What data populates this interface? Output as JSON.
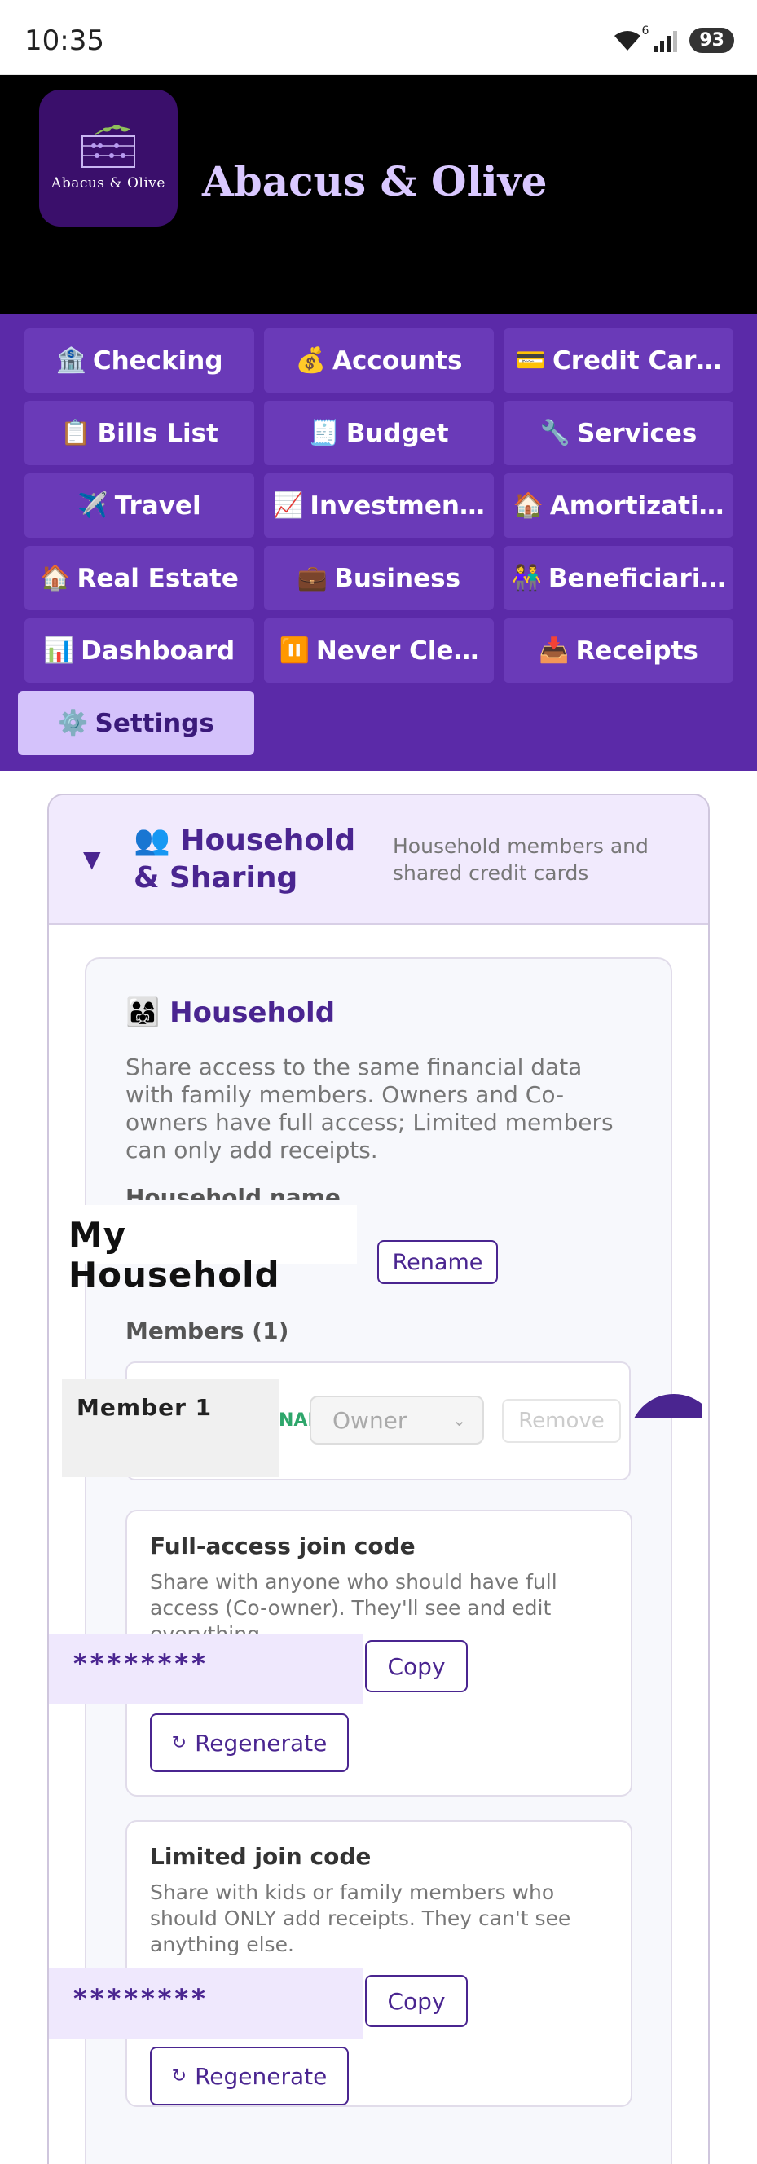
{
  "status": {
    "time": "10:35",
    "wifi_sup": "6",
    "battery": "93"
  },
  "app": {
    "title": "Abacus & Olive",
    "logo_text": "Abacus & Olive"
  },
  "nav": {
    "items": [
      {
        "icon": "🏦",
        "label": "Checking"
      },
      {
        "icon": "💰",
        "label": "Accounts"
      },
      {
        "icon": "💳",
        "label": "Credit Car…"
      },
      {
        "icon": "📋",
        "label": "Bills List"
      },
      {
        "icon": "🧾",
        "label": "Budget"
      },
      {
        "icon": "🔧",
        "label": "Services"
      },
      {
        "icon": "✈️",
        "label": "Travel"
      },
      {
        "icon": "📈",
        "label": "Investmen…"
      },
      {
        "icon": "🏠",
        "label": "Amortizati…"
      },
      {
        "icon": "🏠",
        "label": "Real Estate"
      },
      {
        "icon": "💼",
        "label": "Business"
      },
      {
        "icon": "👫",
        "label": "Beneficiari…"
      },
      {
        "icon": "📊",
        "label": "Dashboard"
      },
      {
        "icon": "⏸️",
        "label": "Never Cle…"
      },
      {
        "icon": "📥",
        "label": "Receipts"
      },
      {
        "icon": "⚙️",
        "label": "Settings"
      }
    ],
    "active": "Settings"
  },
  "section": {
    "caret": "▼",
    "title": "👥 Household & Sharing",
    "subtitle": "Household members and shared credit cards"
  },
  "household": {
    "title": "👨‍👩‍👧 Household",
    "description": "Share access to the same financial data with family members. Owners and Co-owners have full access; Limited members can only add receipts.",
    "name_label": "Household name",
    "name_value": "My Household",
    "rename_label": "Rename",
    "members_label": "Members (1)",
    "member": {
      "name": "Member 1",
      "tag": "NAL",
      "role": "Owner",
      "remove_label": "Remove"
    }
  },
  "full_code": {
    "title": "Full-access join code",
    "description": "Share with anyone who should have full access (Co-owner). They'll see and edit everything.",
    "code": "********",
    "copy_label": "Copy",
    "regenerate_label": "Regenerate"
  },
  "limited_code": {
    "title": "Limited join code",
    "description": "Share with kids or family members who should ONLY add receipts. They can't see anything else.",
    "code": "********",
    "copy_label": "Copy",
    "regenerate_label": "Regenerate"
  }
}
